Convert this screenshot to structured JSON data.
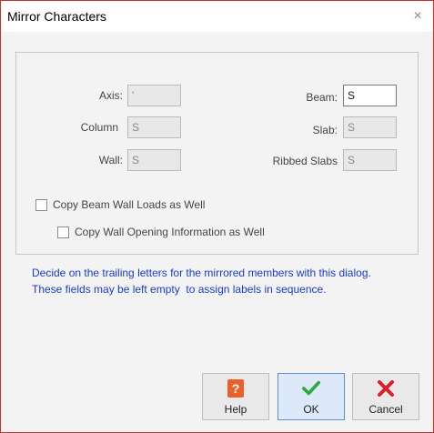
{
  "window": {
    "title": "Mirror Characters",
    "close_glyph": "×"
  },
  "fields": {
    "axis": {
      "label": "Axis:",
      "value": "'"
    },
    "column": {
      "label": "Column",
      "value": "S"
    },
    "wall": {
      "label": "Wall:",
      "value": "S"
    },
    "beam": {
      "label": "Beam:",
      "value": "S"
    },
    "slab": {
      "label": "Slab:",
      "value": "S"
    },
    "ribbed_slabs": {
      "label": "Ribbed Slabs",
      "value": "S"
    }
  },
  "checkboxes": {
    "copy_beam_wall_loads": {
      "label": "Copy Beam Wall Loads as Well",
      "checked": false
    },
    "copy_wall_opening": {
      "label": "Copy Wall Opening Information as Well",
      "checked": false
    }
  },
  "info": {
    "line1": "Decide on the trailing letters for the mirrored members with this dialog.",
    "line2": "These fields may be left empty  to assign labels in sequence."
  },
  "buttons": {
    "help": {
      "label": "Help",
      "icon": "question-icon",
      "color": "#e8612c"
    },
    "ok": {
      "label": "OK",
      "icon": "check-icon",
      "color": "#2eaa3c"
    },
    "cancel": {
      "label": "Cancel",
      "icon": "x-icon",
      "color": "#d9202c"
    }
  }
}
